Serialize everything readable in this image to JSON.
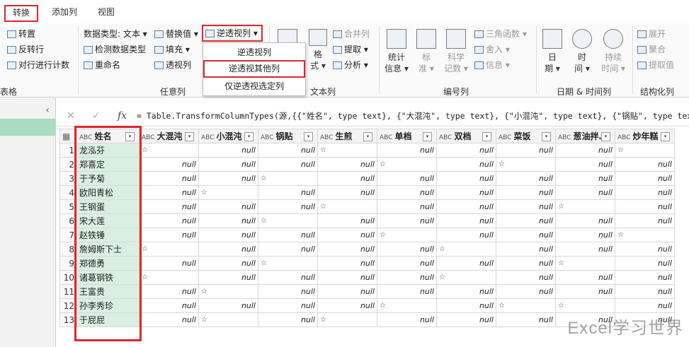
{
  "tabs": [
    "转换",
    "添加列",
    "视图"
  ],
  "ribbon": {
    "group1": {
      "items": [
        "转置",
        "反转行",
        "对行进行计数"
      ],
      "label": "表格"
    },
    "group2": {
      "data_type": "数据类型: 文本 ▾",
      "detect": "检测数据类型",
      "rename": "重命名",
      "replace": "替换值 ▾",
      "fill": "填充 ▾",
      "pivot": "透视列",
      "unpivot": "逆透视列 ▾",
      "label": "任意列"
    },
    "group3": {
      "format": [
        "格",
        "式 ▾"
      ],
      "merge": "合并列",
      "extract": "提取 ▾",
      "parse": "分析 ▾",
      "label": "文本列"
    },
    "group4": {
      "stats": [
        "统计",
        "信息 ▾"
      ],
      "standard": [
        "标",
        "准 ▾"
      ],
      "sci": [
        "科学",
        "记数 ▾"
      ],
      "trig": "三角函数 ▾",
      "round": "舍入 ▾",
      "info": "信息 ▾",
      "label": "编号列"
    },
    "group5": {
      "date": [
        "日",
        "期 ▾"
      ],
      "time": [
        "时",
        "间 ▾"
      ],
      "duration": [
        "持续",
        "时间 ▾"
      ],
      "label": "日期 & 时间列"
    },
    "group6": {
      "expand": "展开",
      "aggregate": "聚合",
      "extract_values": "提取值",
      "label": "结构化列"
    }
  },
  "dropdown": [
    "逆透视列",
    "逆透视其他列",
    "仅逆透视选定列"
  ],
  "formula_bar": {
    "fx": "fx",
    "formula": "= Table.TransformColumnTypes(源,{{\"姓名\", type text}, {\"大混沌\", type text}, {\"小混沌\", type text}, {\"锅贴\", type text}"
  },
  "table": {
    "type_label": "ABC",
    "columns": [
      "姓名",
      "大混沌",
      "小混沌",
      "锅贴",
      "生煎",
      "单档",
      "双档",
      "菜饭",
      "葱油拌…",
      "炒年糕"
    ],
    "rows": [
      [
        "1",
        "龙泓芬",
        "☆",
        "null",
        "null",
        "☆",
        "null",
        "null",
        "null",
        "null",
        "☆"
      ],
      [
        "2",
        "郑喜定",
        "null",
        "null",
        "null",
        "null",
        "☆",
        "null",
        "☆",
        "null",
        "null"
      ],
      [
        "3",
        "于予菊",
        "null",
        "null",
        "☆",
        "null",
        "null",
        "null",
        "null",
        "null",
        "null"
      ],
      [
        "4",
        "欧阳青松",
        "null",
        "☆",
        "null",
        "null",
        "null",
        "null",
        "null",
        "null",
        "null"
      ],
      [
        "5",
        "王钢蛋",
        "null",
        "null",
        "null",
        "☆",
        "null",
        "null",
        "null",
        "☆",
        "null"
      ],
      [
        "6",
        "宋大莲",
        "null",
        "null",
        "☆",
        "null",
        "null",
        "null",
        "null",
        "null",
        "null"
      ],
      [
        "7",
        "赵铁锤",
        "null",
        "null",
        "null",
        "null",
        "☆",
        "null",
        "null",
        "null",
        "☆"
      ],
      [
        "8",
        "詹姆斯下士",
        "☆",
        "null",
        "null",
        "null",
        "null",
        "☆",
        "null",
        "null",
        "null"
      ],
      [
        "9",
        "郑德勇",
        "null",
        "null",
        "☆",
        "null",
        "null",
        "null",
        "null",
        "☆",
        "null"
      ],
      [
        "10",
        "诸葛钢铁",
        "☆",
        "null",
        "null",
        "null",
        "null",
        "☆",
        "null",
        "null",
        "null"
      ],
      [
        "11",
        "王富贵",
        "null",
        "☆",
        "null",
        "null",
        "null",
        "null",
        "null",
        "null",
        "null"
      ],
      [
        "12",
        "孙李秀珍",
        "null",
        "null",
        "null",
        "null",
        "☆",
        "null",
        "☆",
        "☆",
        "null"
      ],
      [
        "13",
        "于屁屁",
        "null",
        "☆",
        "null",
        "☆",
        "null",
        "null",
        "null",
        "null",
        "null"
      ]
    ]
  },
  "watermark": "Excel学习世界"
}
